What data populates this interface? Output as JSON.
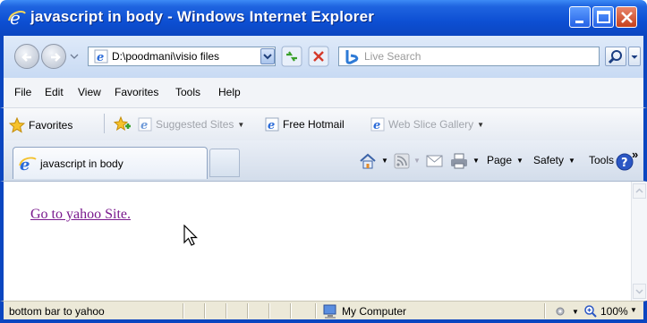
{
  "window": {
    "title": "javascript in body - Windows Internet Explorer"
  },
  "address_bar": {
    "url": "D:\\poodmani\\visio files"
  },
  "search": {
    "placeholder": "Live Search"
  },
  "menu": {
    "items": [
      "File",
      "Edit",
      "View",
      "Favorites",
      "Tools",
      "Help"
    ]
  },
  "favorites_bar": {
    "favorites_label": "Favorites",
    "suggested_sites": "Suggested Sites",
    "free_hotmail": "Free Hotmail",
    "web_slice_gallery": "Web Slice Gallery"
  },
  "tabs": {
    "active_tab_label": "javascript in body"
  },
  "command_bar": {
    "page_label": "Page",
    "safety_label": "Safety",
    "tools_label": "Tools"
  },
  "page": {
    "link_text": "Go to yahoo Site."
  },
  "status_bar": {
    "status_text": "bottom bar to yahoo",
    "zone_label": "My Computer",
    "zoom_label": "100%"
  },
  "colors": {
    "titlebar": "#0d4fd3",
    "visited_link": "#7a1a8e",
    "close_button": "#c5401b"
  }
}
